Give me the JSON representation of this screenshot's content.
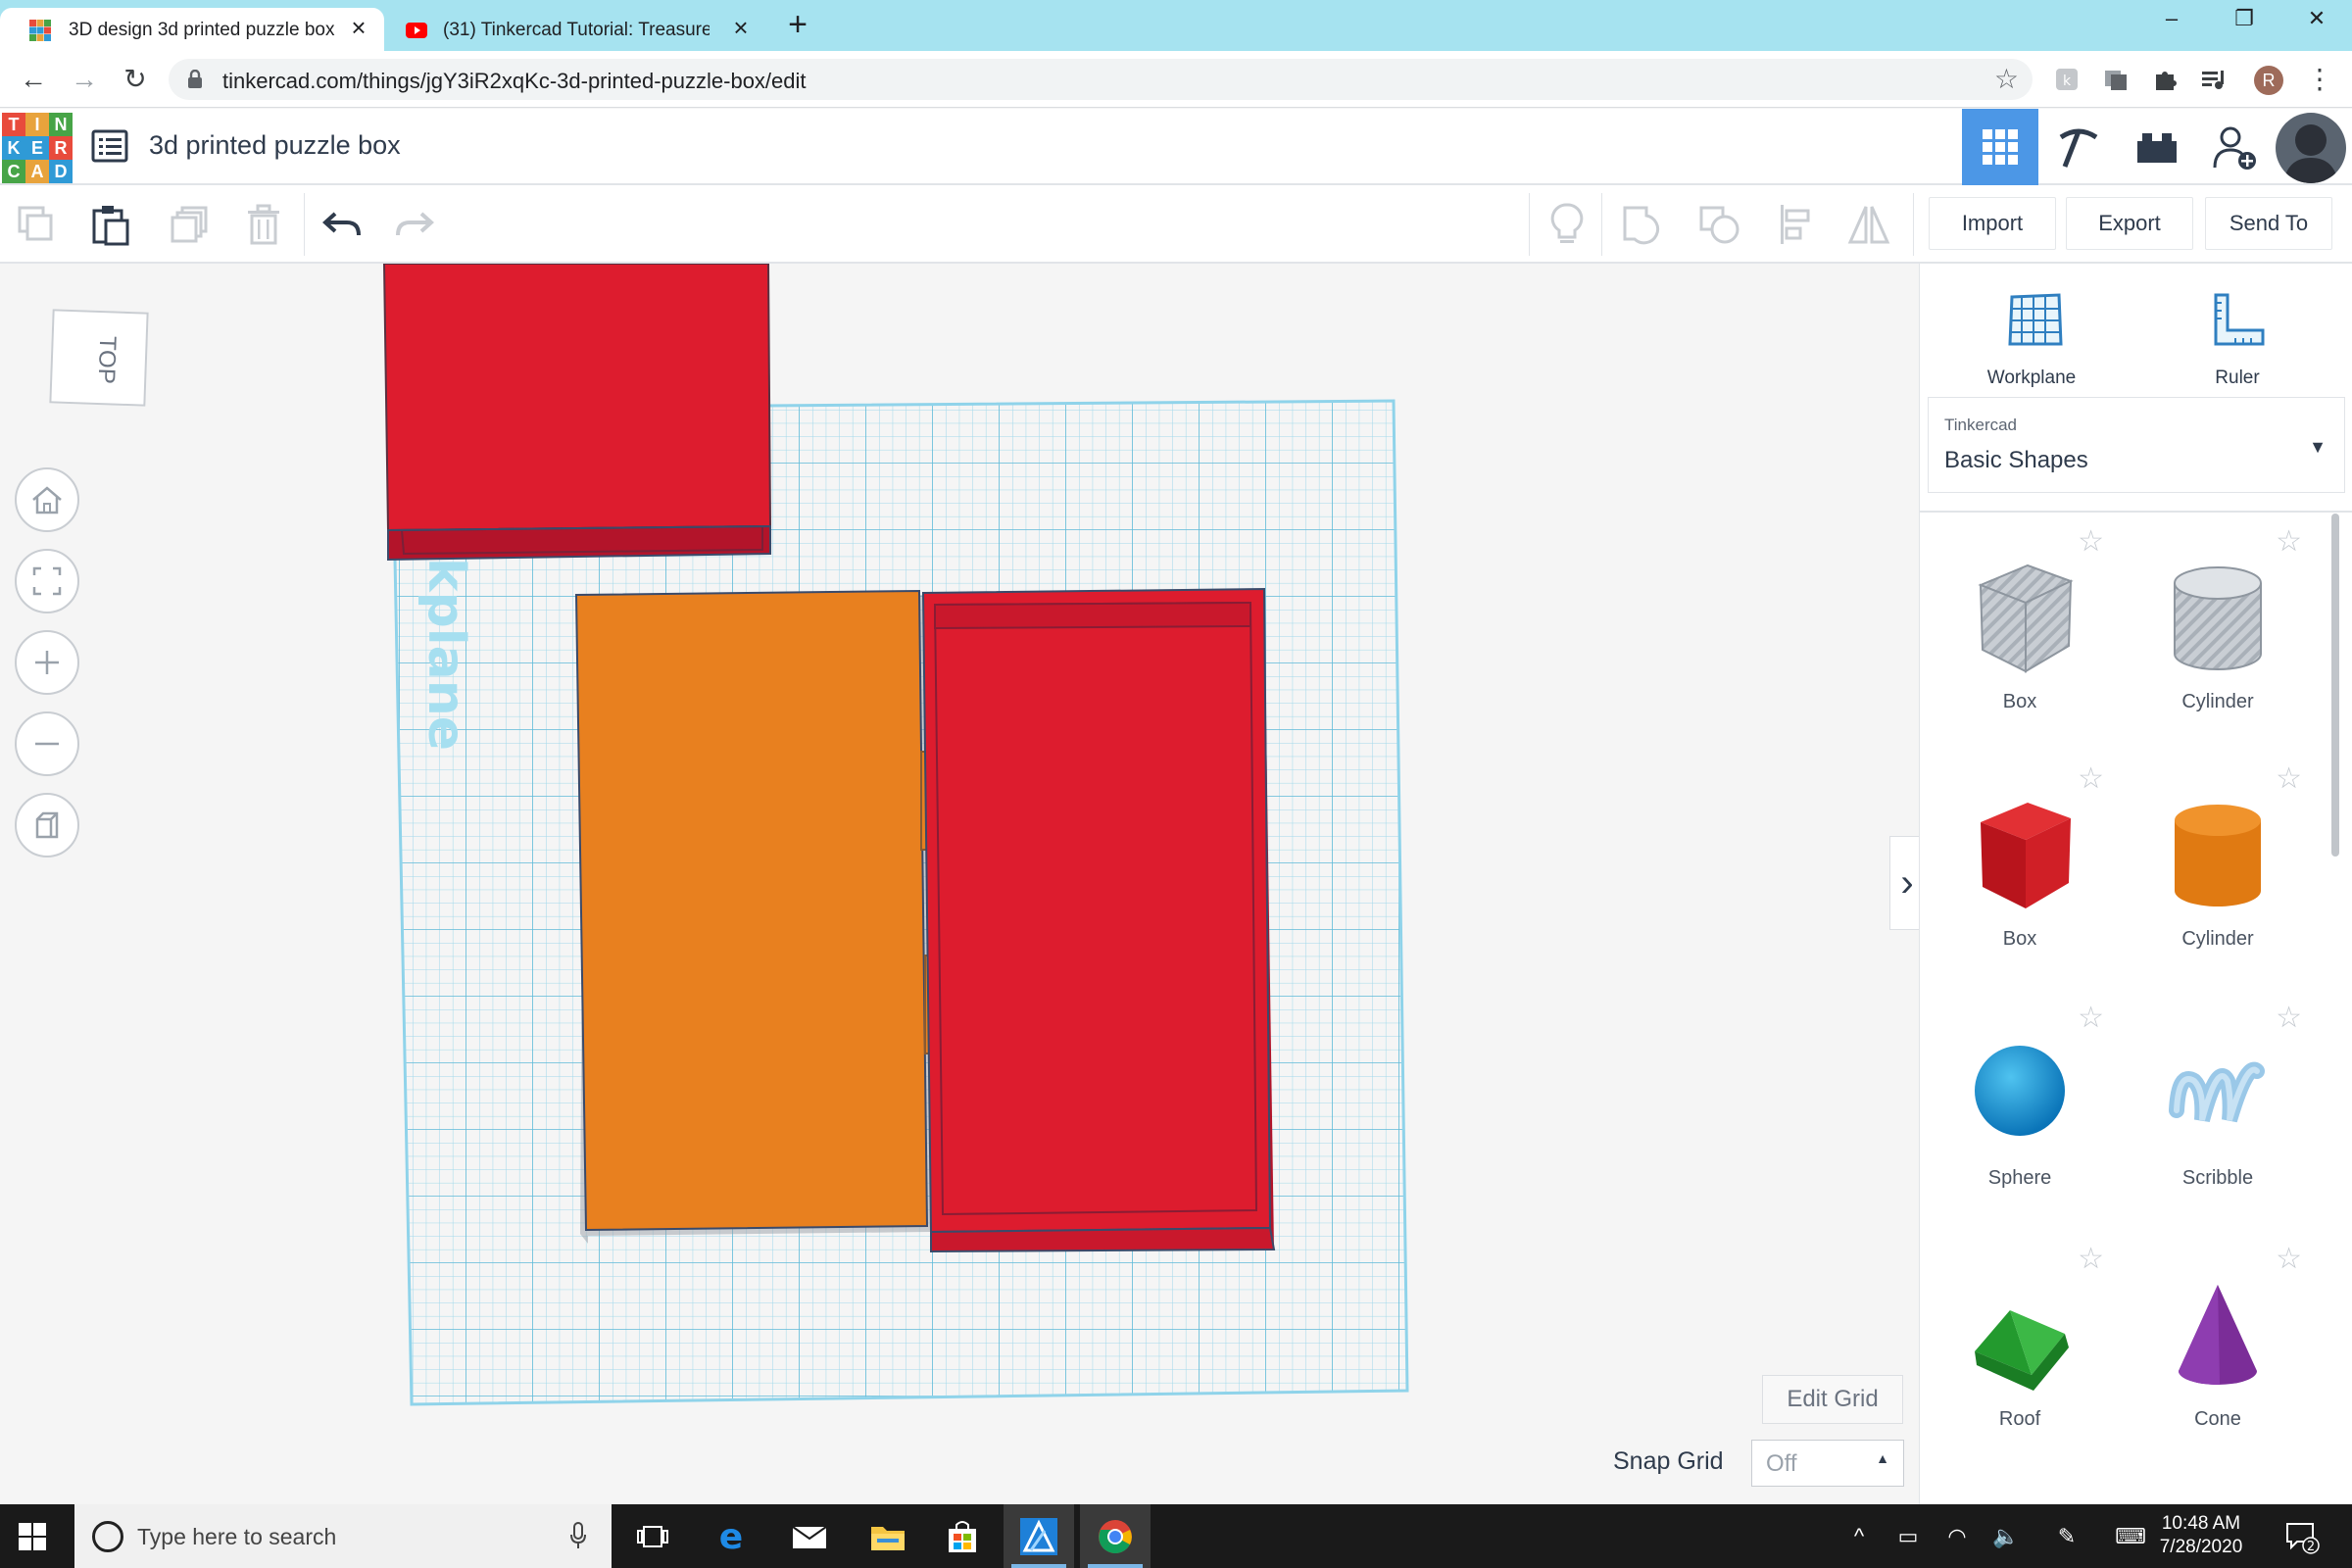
{
  "browser": {
    "tabs": [
      {
        "title": "3D design 3d printed puzzle box",
        "active": true
      },
      {
        "title": "(31) Tinkercad Tutorial: Treasure",
        "active": false
      }
    ],
    "url": "tinkercad.com/things/jgY3iR2xqKc-3d-printed-puzzle-box/edit",
    "profile_initial": "R"
  },
  "app": {
    "logo_letters": [
      "T",
      "I",
      "N",
      "K",
      "E",
      "R",
      "C",
      "A",
      "D"
    ],
    "logo_colors": [
      "#e84b3c",
      "#e8a33c",
      "#47a447",
      "#2f9ad6",
      "#2f9ad6",
      "#e84b3c",
      "#47a447",
      "#e8a33c",
      "#2f9ad6"
    ],
    "design_title": "3d printed puzzle box",
    "toolbar": {
      "import_label": "Import",
      "export_label": "Export",
      "send_to_label": "Send To"
    },
    "viewcube_label": "TOP",
    "workplane_watermark": "kplane",
    "edit_grid_label": "Edit Grid",
    "snap_grid_label": "Snap Grid",
    "snap_grid_value": "Off"
  },
  "panel": {
    "workplane_label": "Workplane",
    "ruler_label": "Ruler",
    "library_provider": "Tinkercad",
    "library_name": "Basic Shapes",
    "shapes": [
      {
        "name": "Box",
        "icon": "box-hole-icon"
      },
      {
        "name": "Cylinder",
        "icon": "cylinder-hole-icon"
      },
      {
        "name": "Box",
        "icon": "box-solid-icon"
      },
      {
        "name": "Cylinder",
        "icon": "cylinder-solid-icon"
      },
      {
        "name": "Sphere",
        "icon": "sphere-icon"
      },
      {
        "name": "Scribble",
        "icon": "scribble-icon"
      },
      {
        "name": "Roof",
        "icon": "roof-icon"
      },
      {
        "name": "Cone",
        "icon": "cone-icon"
      }
    ]
  },
  "colors": {
    "red_shape": "#dd1c2e",
    "orange_shape": "#e8801f",
    "grid_line": "#86cfe6",
    "accent_blue": "#4c97e6"
  },
  "taskbar": {
    "search_placeholder": "Type here to search",
    "time": "10:48 AM",
    "date": "7/28/2020",
    "notification_count": "2"
  }
}
